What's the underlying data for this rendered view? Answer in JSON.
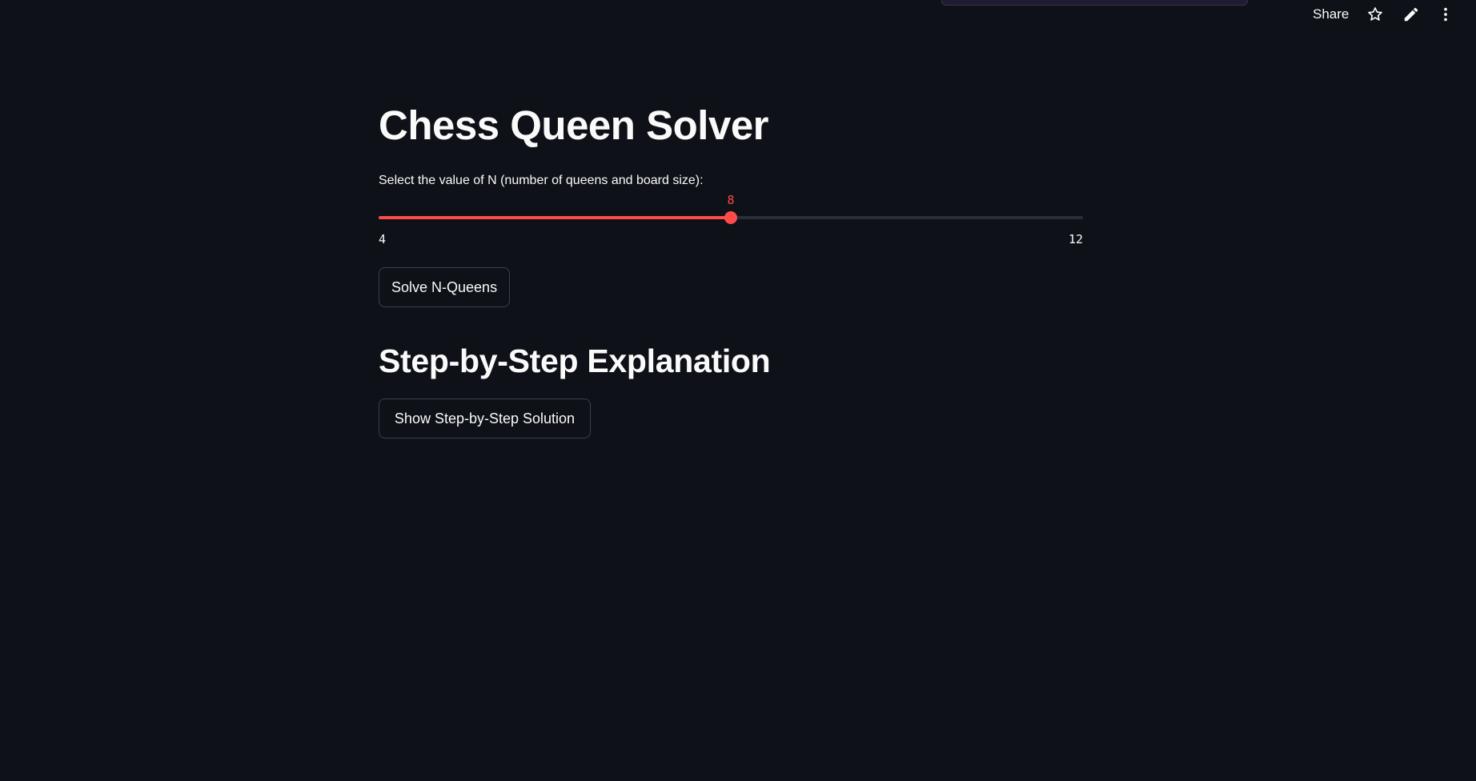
{
  "header": {
    "share_label": "Share",
    "icons": [
      "star-icon",
      "pencil-icon",
      "more-vertical-icon"
    ]
  },
  "main": {
    "title": "Chess Queen Solver",
    "slider": {
      "label": "Select the value of N (number of queens and board size):",
      "value": "8",
      "min": "4",
      "max": "12",
      "fraction": 0.5,
      "accent_color": "#ff4b4b"
    },
    "solve_button_label": "Solve N-Queens",
    "section_title": "Step-by-Step Explanation",
    "steps_button_label": "Show Step-by-Step Solution"
  },
  "colors": {
    "background": "#0e1117",
    "text": "#fafafa",
    "accent": "#ff4b4b"
  }
}
